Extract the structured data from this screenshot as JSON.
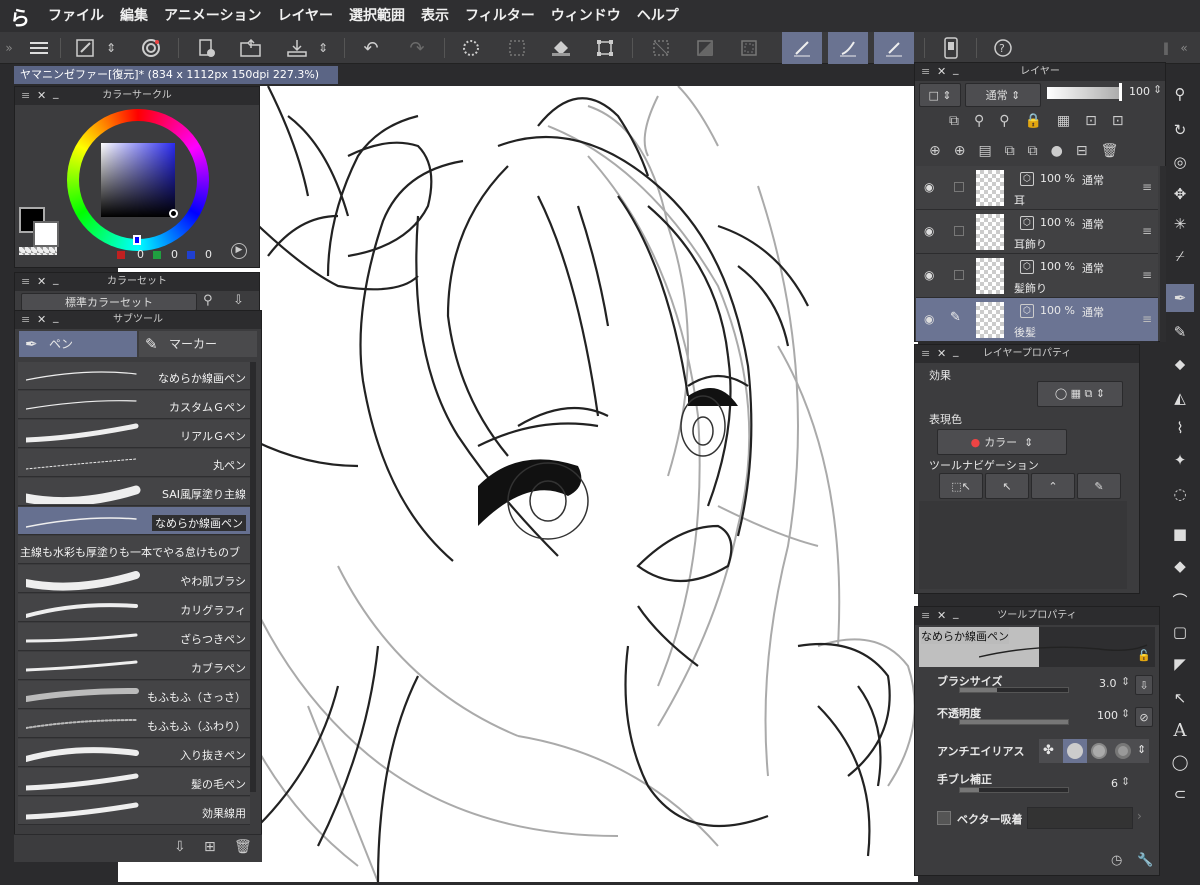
{
  "menubar": {
    "logo": "ら",
    "items": [
      "ファイル",
      "編集",
      "アニメーション",
      "レイヤー",
      "選択範囲",
      "表示",
      "フィルター",
      "ウィンドウ",
      "ヘルプ"
    ]
  },
  "document": {
    "tab_title": "ヤマニンゼファー[復元]* (834 x 1112px 150dpi 227.3%)"
  },
  "color_circle": {
    "title": "カラーサークル",
    "main_color": "#000000",
    "sub_color": "#ffffff",
    "r": "0",
    "g": "0",
    "b": "0"
  },
  "color_set": {
    "title": "カラーセット",
    "selected": "標準カラーセット"
  },
  "subtool": {
    "title": "サブツール",
    "tabs": [
      "ペン",
      "マーカー"
    ],
    "brushes": [
      "なめらか線画ペン",
      "カスタムＧペン",
      "リアルＧペン",
      "丸ペン",
      "SAI風厚塗り主線",
      "なめらか線画ペン",
      "主線も水彩も厚塗りも一本でやる怠けものブ",
      "やわ肌ブラシ",
      "カリグラフィ",
      "ざらつきペン",
      "カブラペン",
      "もふもふ（さっさ）",
      "もふもふ（ふわり）",
      "入り抜きペン",
      "髪の毛ペン",
      "効果線用"
    ]
  },
  "layer_panel": {
    "title": "レイヤー",
    "blend_mode": "通常",
    "opacity": "100",
    "layers": [
      {
        "opacity": "100 %",
        "mode": "通常",
        "name": "耳"
      },
      {
        "opacity": "100 %",
        "mode": "通常",
        "name": "耳飾り"
      },
      {
        "opacity": "100 %",
        "mode": "通常",
        "name": "髪飾り"
      },
      {
        "opacity": "100 %",
        "mode": "通常",
        "name": "後髪"
      }
    ]
  },
  "layer_property": {
    "title": "レイヤープロパティ",
    "effect_label": "効果",
    "expression_label": "表現色",
    "expression_value": "カラー",
    "tool_nav_label": "ツールナビゲーション"
  },
  "tool_property": {
    "title": "ツールプロパティ",
    "preview_name": "なめらか線画ペン",
    "brush_size_label": "ブラシサイズ",
    "brush_size_value": "3.0",
    "opacity_label": "不透明度",
    "opacity_value": "100",
    "antialias_label": "アンチエイリアス",
    "stabilization_label": "手ブレ補正",
    "stabilization_value": "6",
    "vector_snap_label": "ベクター吸着"
  },
  "right_tools": {
    "text_tool": "A"
  }
}
